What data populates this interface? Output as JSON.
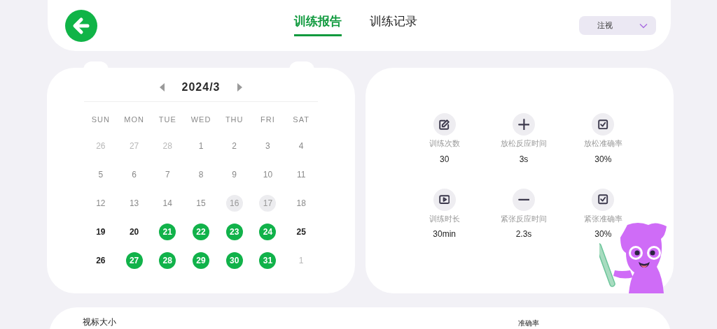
{
  "header": {
    "tabs": [
      {
        "label": "训练报告",
        "selected": true
      },
      {
        "label": "训练记录",
        "selected": false
      }
    ],
    "dropdown": {
      "value": "注视"
    }
  },
  "calendar": {
    "month": "2024/3",
    "weekdays": [
      "SUN",
      "MON",
      "TUE",
      "WED",
      "THU",
      "FRI",
      "SAT"
    ],
    "days": [
      {
        "label": "26",
        "kind": "outside"
      },
      {
        "label": "27",
        "kind": "outside"
      },
      {
        "label": "28",
        "kind": "outside"
      },
      {
        "label": "1",
        "kind": "plain"
      },
      {
        "label": "2",
        "kind": "plain"
      },
      {
        "label": "3",
        "kind": "plain"
      },
      {
        "label": "4",
        "kind": "plain"
      },
      {
        "label": "5",
        "kind": "plain"
      },
      {
        "label": "6",
        "kind": "plain"
      },
      {
        "label": "7",
        "kind": "plain"
      },
      {
        "label": "8",
        "kind": "plain"
      },
      {
        "label": "9",
        "kind": "plain"
      },
      {
        "label": "10",
        "kind": "plain"
      },
      {
        "label": "11",
        "kind": "plain"
      },
      {
        "label": "12",
        "kind": "plain"
      },
      {
        "label": "13",
        "kind": "plain"
      },
      {
        "label": "14",
        "kind": "plain"
      },
      {
        "label": "15",
        "kind": "plain"
      },
      {
        "label": "16",
        "kind": "missed"
      },
      {
        "label": "17",
        "kind": "missed"
      },
      {
        "label": "18",
        "kind": "plain"
      },
      {
        "label": "19",
        "kind": "strong"
      },
      {
        "label": "20",
        "kind": "strong"
      },
      {
        "label": "21",
        "kind": "trained"
      },
      {
        "label": "22",
        "kind": "trained"
      },
      {
        "label": "23",
        "kind": "trained"
      },
      {
        "label": "24",
        "kind": "trained"
      },
      {
        "label": "25",
        "kind": "strong"
      },
      {
        "label": "26",
        "kind": "strong"
      },
      {
        "label": "27",
        "kind": "trained"
      },
      {
        "label": "28",
        "kind": "trained"
      },
      {
        "label": "29",
        "kind": "trained"
      },
      {
        "label": "30",
        "kind": "trained"
      },
      {
        "label": "31",
        "kind": "trained"
      },
      {
        "label": "1",
        "kind": "outside"
      }
    ]
  },
  "stats": [
    {
      "kind": "count",
      "label": "训练次数",
      "value": "30"
    },
    {
      "kind": "relax_time",
      "label": "放松反应时间",
      "value": "3s"
    },
    {
      "kind": "accuracy",
      "label": "放松准确率",
      "value": "30%"
    },
    {
      "kind": "duration",
      "label": "训练时长",
      "value": "30min"
    },
    {
      "kind": "tense_time",
      "label": "紧张反应时间",
      "value": "2.3s"
    },
    {
      "kind": "accuracy",
      "label": "紧张准确率",
      "value": "30%"
    }
  ],
  "bottom_card": {
    "title": "视标大小",
    "column_label": "准确率"
  }
}
